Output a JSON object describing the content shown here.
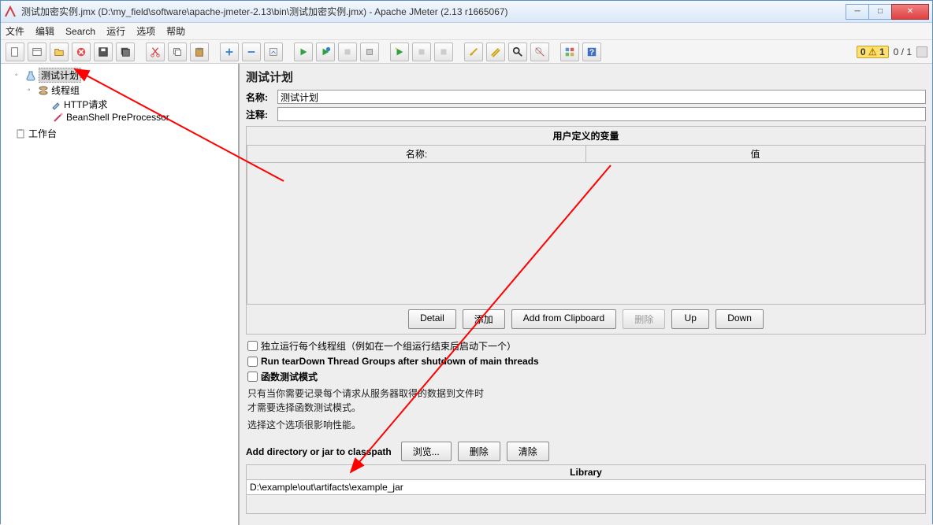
{
  "window": {
    "title": "测试加密实例.jmx (D:\\my_field\\software\\apache-jmeter-2.13\\bin\\测试加密实例.jmx) - Apache JMeter (2.13 r1665067)"
  },
  "menubar": [
    "文件",
    "编辑",
    "Search",
    "运行",
    "选项",
    "帮助"
  ],
  "toolbar_status": {
    "warn_count": "1",
    "run_count": "0 / 1"
  },
  "tree": {
    "root": "测试计划",
    "thread_group": "线程组",
    "http": "HTTP请求",
    "beanshell": "BeanShell PreProcessor",
    "workbench": "工作台"
  },
  "panel": {
    "title": "测试计划",
    "name_label": "名称:",
    "name_value": "测试计划",
    "comment_label": "注释:",
    "comment_value": "",
    "vars_section_title": "用户定义的变量",
    "vars_col_name": "名称:",
    "vars_col_value": "值",
    "buttons": {
      "detail": "Detail",
      "add": "添加",
      "add_clipboard": "Add from Clipboard",
      "delete": "删除",
      "up": "Up",
      "down": "Down"
    },
    "check1": "独立运行每个线程组（例如在一个组运行结束后启动下一个）",
    "check2": "Run tearDown Thread Groups after shutdown of main threads",
    "check3": "函数测试模式",
    "desc1": "只有当你需要记录每个请求从服务器取得的数据到文件时",
    "desc2": "才需要选择函数测试模式。",
    "desc3": "选择这个选项很影响性能。",
    "lib_label": "Add directory or jar to classpath",
    "lib_buttons": {
      "browse": "浏览...",
      "delete": "删除",
      "clear": "清除"
    },
    "lib_col": "Library",
    "lib_value": "D:\\example\\out\\artifacts\\example_jar"
  }
}
